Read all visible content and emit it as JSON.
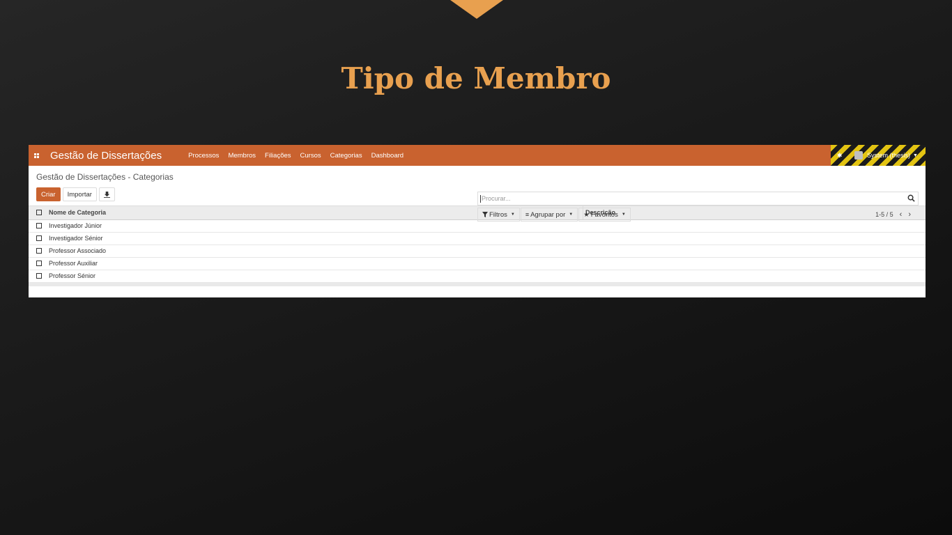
{
  "slide": {
    "title": "Tipo de Membro"
  },
  "navbar": {
    "brand": "Gestão de Dissertações",
    "menu": [
      "Processos",
      "Membros",
      "Filiações",
      "Cursos",
      "Categorias",
      "Dashboard"
    ],
    "user": "System (thesis)"
  },
  "control": {
    "breadcrumb": "Gestão de Dissertações - Categorias",
    "create_label": "Criar",
    "import_label": "Importar",
    "search_placeholder": "Procurar...",
    "filters_label": "Filtros",
    "groupby_label": "Agrupar por",
    "favorites_label": "Favoritos",
    "pager": "1-5 / 5"
  },
  "table": {
    "headers": {
      "name": "Nome de Categoria",
      "desc": "Descrição"
    },
    "rows": [
      {
        "name": "Investigador Júnior",
        "desc": ""
      },
      {
        "name": "Investigador Sénior",
        "desc": ""
      },
      {
        "name": "Professor Associado",
        "desc": ""
      },
      {
        "name": "Professor Auxiliar",
        "desc": ""
      },
      {
        "name": "Professor Sénior",
        "desc": ""
      }
    ]
  },
  "colors": {
    "accent": "#c9622f",
    "title": "#e8a04f"
  }
}
